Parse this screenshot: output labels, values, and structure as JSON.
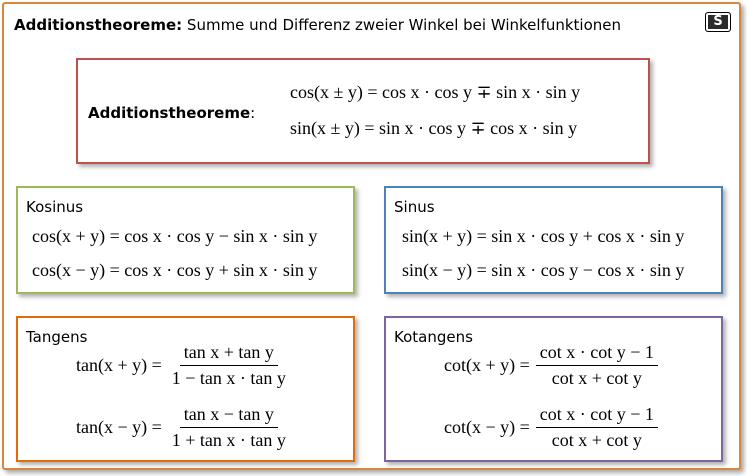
{
  "header": {
    "title_bold": "Additionstheoreme:",
    "title_rest": " Summe und Differenz zweier Winkel bei Winkelfunktionen",
    "logo": "S"
  },
  "main": {
    "label": "Additionstheoreme",
    "colon": ":",
    "formula_cos": "cos(x ± y) = cos x · cos y ∓ sin x · sin y",
    "formula_sin": "sin(x ± y) = sin x · cos y ∓ cos x · sin y"
  },
  "kosinus": {
    "title": "Kosinus",
    "f1": "cos(x + y) = cos x · cos y − sin x · sin y",
    "f2": "cos(x − y) = cos x · cos y + sin x · sin y"
  },
  "sinus": {
    "title": "Sinus",
    "f1": "sin(x + y) = sin x · cos y + cos x · sin y",
    "f2": "sin(x − y) = sin x · cos y − cos x · sin y"
  },
  "tangens": {
    "title": "Tangens",
    "f1_lhs": "tan(x + y) =",
    "f1_num": "tan x + tan y",
    "f1_den": "1 − tan x · tan y",
    "f2_lhs": "tan(x − y) =",
    "f2_num": "tan x − tan y",
    "f2_den": "1 + tan x · tan y"
  },
  "kotangens": {
    "title": "Kotangens",
    "f1_lhs": "cot(x + y) =",
    "f1_num": "cot x · cot y − 1",
    "f1_den": "cot x + cot y",
    "f2_lhs": "cot(x − y) =",
    "f2_num": "cot x · cot y − 1",
    "f2_den": "cot x + cot y"
  },
  "colors": {
    "frame": "#d9873c",
    "main": "#c0504d",
    "kosinus": "#9bbb59",
    "sinus": "#4f81bd",
    "tangens": "#e36c09",
    "kotangens": "#8064a2"
  }
}
